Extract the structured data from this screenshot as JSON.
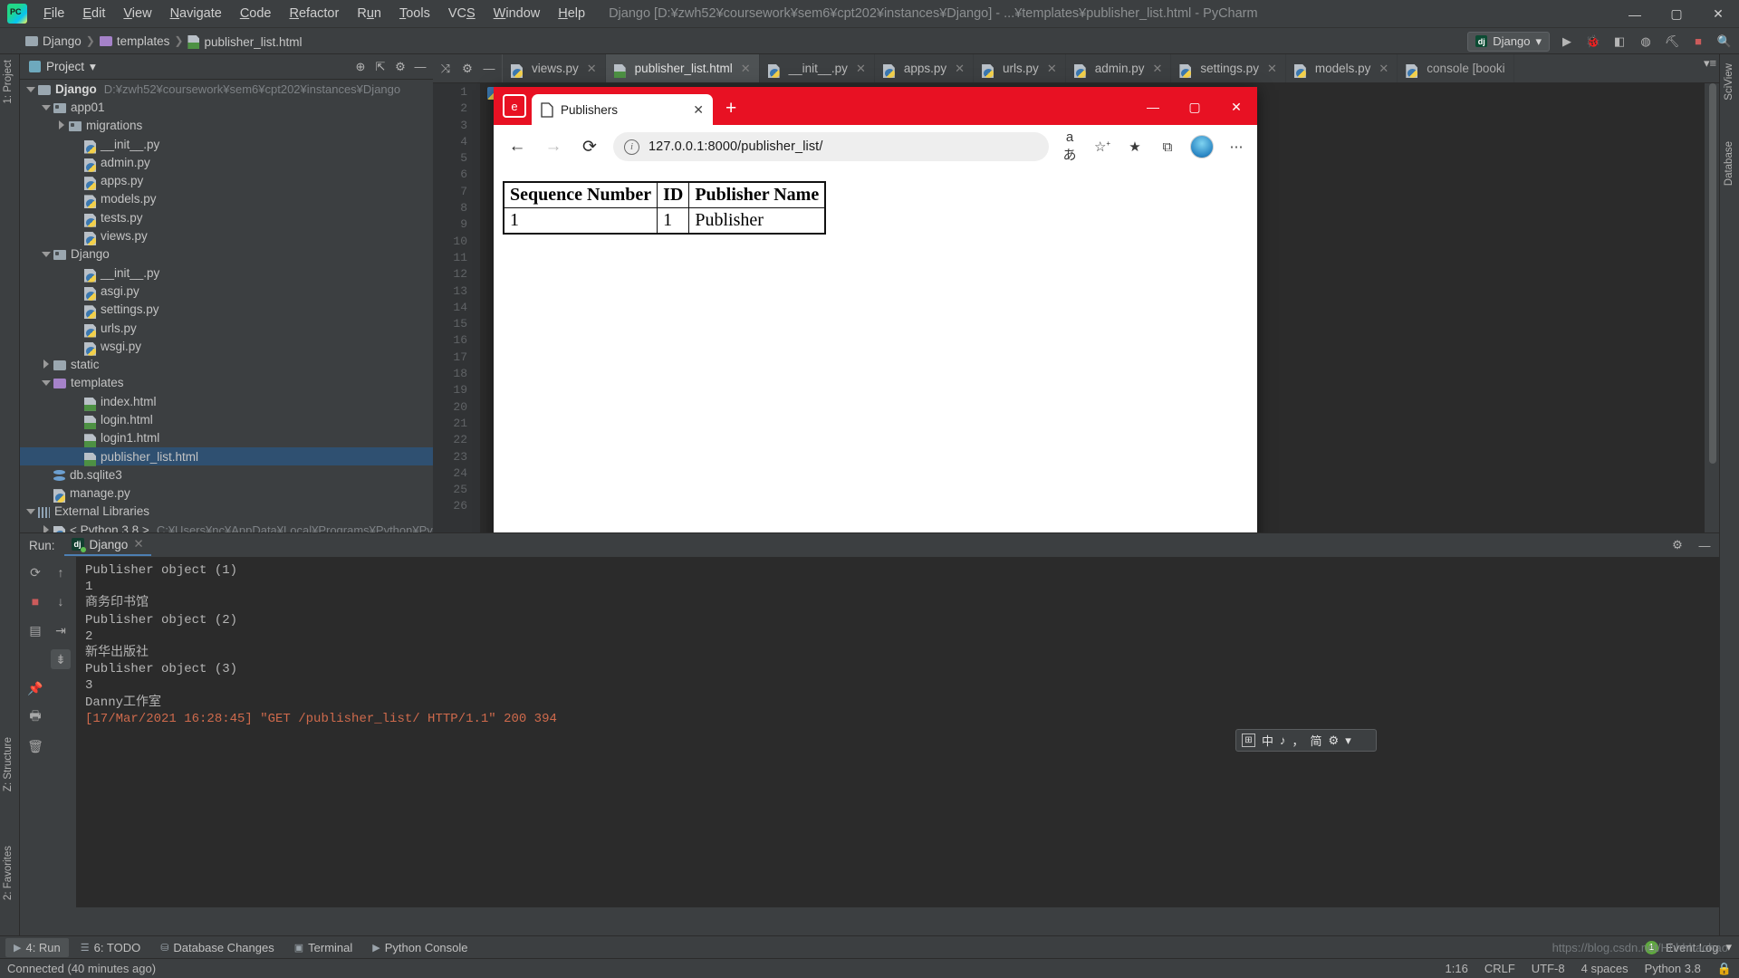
{
  "titlebar": {
    "logo_name": "pycharm-logo",
    "menus": [
      "File",
      "Edit",
      "View",
      "Navigate",
      "Code",
      "Refactor",
      "Run",
      "Tools",
      "VCS",
      "Window",
      "Help"
    ],
    "window_title": "Django [D:¥zwh52¥coursework¥sem6¥cpt202¥instances¥Django] - ...¥templates¥publisher_list.html - PyCharm",
    "minimize": "—",
    "maximize": "▢",
    "close": "✕"
  },
  "navbar": {
    "crumbs": [
      {
        "label": "Django",
        "icon": "folder-gray"
      },
      {
        "label": "templates",
        "icon": "folder-purple"
      },
      {
        "label": "publisher_list.html",
        "icon": "html-file"
      }
    ],
    "separator": "❯",
    "run_config": "Django",
    "run_config_caret": "▾",
    "icons": [
      "run-icon",
      "debug-icon",
      "coverage-icon",
      "profile-icon",
      "build-icon",
      "stop-icon",
      "search-icon"
    ]
  },
  "left_tool_tabs": [
    "1: Project",
    "2: Favorites",
    "Z: Structure"
  ],
  "right_tool_tabs": [
    "SciView",
    "Database"
  ],
  "project_panel": {
    "title": "Project",
    "caret": "▾",
    "tree": [
      {
        "label": "Django",
        "path": "D:¥zwh52¥coursework¥sem6¥cpt202¥instances¥Django",
        "indent": 0,
        "arrow": "down",
        "icon": "folder-gray",
        "bold": true
      },
      {
        "label": "app01",
        "indent": 1,
        "arrow": "down",
        "icon": "folder-module"
      },
      {
        "label": "migrations",
        "indent": 2,
        "arrow": "right",
        "icon": "folder-module"
      },
      {
        "label": "__init__.py",
        "indent": 3,
        "arrow": "none",
        "icon": "python-file"
      },
      {
        "label": "admin.py",
        "indent": 3,
        "arrow": "none",
        "icon": "python-file"
      },
      {
        "label": "apps.py",
        "indent": 3,
        "arrow": "none",
        "icon": "python-file"
      },
      {
        "label": "models.py",
        "indent": 3,
        "arrow": "none",
        "icon": "python-file"
      },
      {
        "label": "tests.py",
        "indent": 3,
        "arrow": "none",
        "icon": "python-file"
      },
      {
        "label": "views.py",
        "indent": 3,
        "arrow": "none",
        "icon": "python-file"
      },
      {
        "label": "Django",
        "indent": 1,
        "arrow": "down",
        "icon": "folder-module"
      },
      {
        "label": "__init__.py",
        "indent": 3,
        "arrow": "none",
        "icon": "python-file"
      },
      {
        "label": "asgi.py",
        "indent": 3,
        "arrow": "none",
        "icon": "python-file"
      },
      {
        "label": "settings.py",
        "indent": 3,
        "arrow": "none",
        "icon": "python-file"
      },
      {
        "label": "urls.py",
        "indent": 3,
        "arrow": "none",
        "icon": "python-file"
      },
      {
        "label": "wsgi.py",
        "indent": 3,
        "arrow": "none",
        "icon": "python-file"
      },
      {
        "label": "static",
        "indent": 1,
        "arrow": "right",
        "icon": "folder-gray"
      },
      {
        "label": "templates",
        "indent": 1,
        "arrow": "down",
        "icon": "folder-purple"
      },
      {
        "label": "index.html",
        "indent": 3,
        "arrow": "none",
        "icon": "html-file"
      },
      {
        "label": "login.html",
        "indent": 3,
        "arrow": "none",
        "icon": "html-file"
      },
      {
        "label": "login1.html",
        "indent": 3,
        "arrow": "none",
        "icon": "html-file"
      },
      {
        "label": "publisher_list.html",
        "indent": 3,
        "arrow": "none",
        "icon": "html-file",
        "selected": true
      },
      {
        "label": "db.sqlite3",
        "indent": 1,
        "arrow": "none",
        "icon": "sqlite-file"
      },
      {
        "label": "manage.py",
        "indent": 1,
        "arrow": "none",
        "icon": "python-file"
      },
      {
        "label": "External Libraries",
        "indent": 0,
        "arrow": "down",
        "icon": "libraries"
      },
      {
        "label": "< Python 3.8 >",
        "path": "C:¥Users¥nc¥AppData¥Local¥Programs¥Python¥Py",
        "indent": 1,
        "arrow": "right",
        "icon": "python-sdk"
      }
    ]
  },
  "editor": {
    "tabs": [
      {
        "label": "views.py",
        "icon": "python-file",
        "active": false
      },
      {
        "label": "publisher_list.html",
        "icon": "html-file",
        "active": true
      },
      {
        "label": "__init__.py",
        "icon": "python-file",
        "active": false
      },
      {
        "label": "apps.py",
        "icon": "python-file",
        "active": false
      },
      {
        "label": "urls.py",
        "icon": "python-file",
        "active": false
      },
      {
        "label": "admin.py",
        "icon": "python-file",
        "active": false
      },
      {
        "label": "settings.py",
        "icon": "python-file",
        "active": false
      },
      {
        "label": "models.py",
        "icon": "python-file",
        "active": false
      }
    ],
    "tab_close": "✕",
    "console_tab": "console [booki",
    "line_numbers": [
      "1",
      "2",
      "3",
      "4",
      "5",
      "6",
      "7",
      "8",
      "9",
      "10",
      "11",
      "12",
      "13",
      "14",
      "15",
      "16",
      "17",
      "18",
      "19",
      "20",
      "21",
      "22",
      "23",
      "24",
      "25",
      "26"
    ],
    "toolbar_icons": [
      "expand-icon",
      "collapse-icon",
      "settings-icon",
      "hide-icon"
    ]
  },
  "browser": {
    "tab_title": "Publishers",
    "tab_icon": "page-icon",
    "tab_close": "✕",
    "new_tab": "+",
    "shield_icon": "ie-mode-icon",
    "minimize": "—",
    "maximize": "▢",
    "close": "✕",
    "back_icon": "←",
    "forward_icon": "→",
    "reload_icon": "⟳",
    "info_icon": "ⓘ",
    "url": "127.0.0.1:8000/publisher_list/",
    "actions": [
      "aあ",
      "read-aloud-icon",
      "favorite-icon",
      "collections-icon"
    ],
    "avatar": "profile-avatar",
    "more": "⋯",
    "table": {
      "headers": [
        "Sequence Number",
        "ID",
        "Publisher Name"
      ],
      "rows": [
        [
          "1",
          "1",
          "Publisher"
        ]
      ]
    }
  },
  "run_panel": {
    "label": "Run:",
    "tab": "Django",
    "tab_close": "✕",
    "gutter_icons": [
      "rerun-icon",
      "stop-icon",
      "layout-icon",
      "pin-icon",
      "print-icon",
      "trash-icon",
      "up-icon",
      "down-icon",
      "wrap-icon",
      "scroll-end-icon"
    ],
    "settings_icon": "⚙",
    "hide_icon": "—",
    "console_lines": [
      {
        "text": "Publisher object (1)",
        "style": "normal"
      },
      {
        "text": "1",
        "style": "normal"
      },
      {
        "text": "商务印书馆",
        "style": "normal"
      },
      {
        "text": "Publisher object (2)",
        "style": "normal"
      },
      {
        "text": "2",
        "style": "normal"
      },
      {
        "text": "新华出版社",
        "style": "normal"
      },
      {
        "text": "Publisher object (3)",
        "style": "normal"
      },
      {
        "text": "3",
        "style": "normal"
      },
      {
        "text": "Danny工作室",
        "style": "normal"
      },
      {
        "text": "[17/Mar/2021 16:28:45] \"GET /publisher_list/ HTTP/1.1\" 200 394",
        "style": "red"
      }
    ]
  },
  "ime": {
    "grid_icon": "⊞",
    "lang": "中",
    "tone": "♪",
    "punct": "，",
    "mode": "简",
    "gear": "⚙",
    "more": "▾"
  },
  "bottom_tabs": [
    {
      "label": "4: Run",
      "icon": "▶",
      "active": true
    },
    {
      "label": "6: TODO",
      "icon": "☰",
      "active": false
    },
    {
      "label": "Database Changes",
      "icon": "⛁",
      "active": false
    },
    {
      "label": "Terminal",
      "icon": "▣",
      "active": false
    },
    {
      "label": "Python Console",
      "icon": "▶",
      "active": false
    }
  ],
  "event_log": {
    "label": "Event Log",
    "badge": "1"
  },
  "statusbar": {
    "connection": "Connected (40 minutes ago)",
    "caret": "1:16",
    "line_sep": "CRLF",
    "encoding": "UTF-8",
    "indent": "4 spaces",
    "interpreter": "Python 3.8",
    "lock_icon": "🔒"
  },
  "watermark": "https://blog.csdn.net/Hhhhhaohao",
  "colors": {
    "accent_red": "#e81123",
    "ide_bg": "#3c3f41",
    "editor_bg": "#2b2b2b",
    "selection": "#2f5071",
    "console_error": "#cf6a4c"
  }
}
